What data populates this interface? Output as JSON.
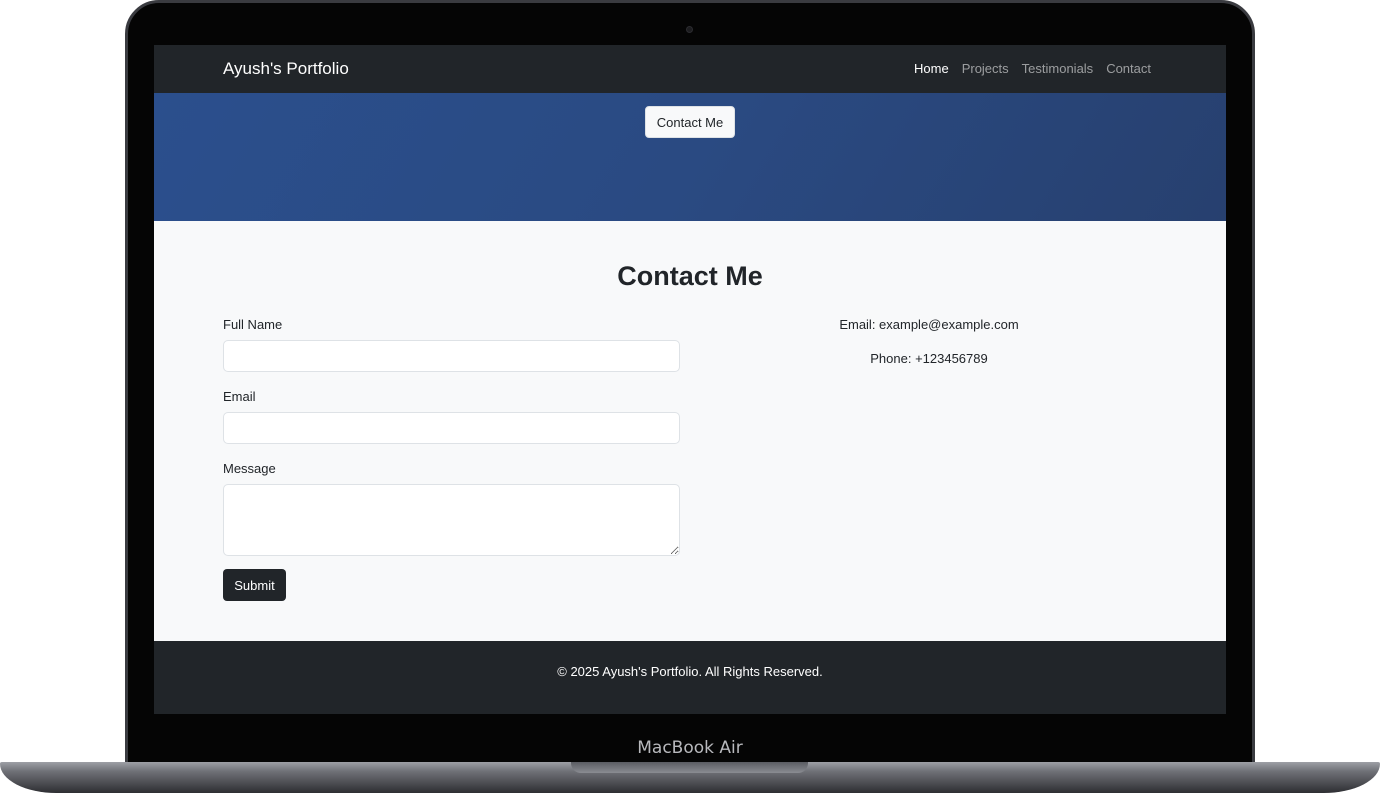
{
  "device": {
    "label": "MacBook Air"
  },
  "navbar": {
    "brand": "Ayush's Portfolio",
    "links": [
      {
        "label": "Home",
        "active": true
      },
      {
        "label": "Projects",
        "active": false
      },
      {
        "label": "Testimonials",
        "active": false
      },
      {
        "label": "Contact",
        "active": false
      }
    ]
  },
  "hero": {
    "button_label": "Contact Me"
  },
  "contact": {
    "title": "Contact Me",
    "fields": {
      "full_name": {
        "label": "Full Name",
        "value": ""
      },
      "email": {
        "label": "Email",
        "value": ""
      },
      "message": {
        "label": "Message",
        "value": ""
      }
    },
    "submit_label": "Submit",
    "info": {
      "email": "Email: example@example.com",
      "phone": "Phone: +123456789"
    }
  },
  "footer": {
    "text": "© 2025 Ayush's Portfolio. All Rights Reserved."
  },
  "colors": {
    "navbar_bg": "#212529",
    "hero_gradient_start": "#2b4f8d",
    "hero_gradient_end": "#27406f",
    "section_bg": "#f8f9fa",
    "footer_bg": "#212529"
  }
}
